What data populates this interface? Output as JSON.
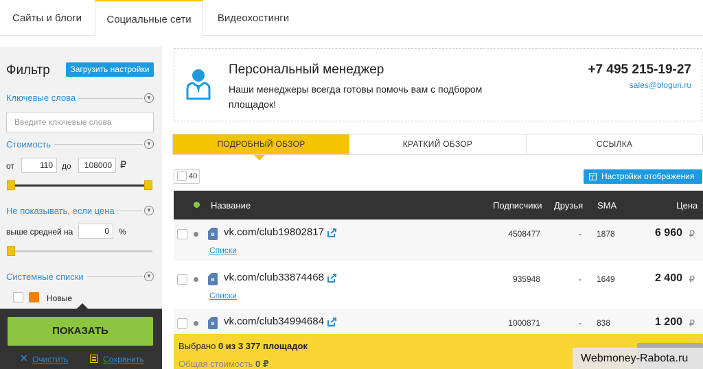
{
  "top_tabs": [
    {
      "label": "Сайты и блоги"
    },
    {
      "label": "Социальные сети"
    },
    {
      "label": "Видеохостинги"
    }
  ],
  "filter": {
    "title": "Фильтр",
    "load_settings": "Загрузить настройки",
    "keywords_label": "Ключевые слова",
    "keywords_placeholder": "Введите ключевые слова",
    "cost_label": "Стоимость",
    "from_label": "от",
    "from_value": "110",
    "to_label": "до",
    "to_value": "108000",
    "currency": "₽",
    "hide_label": "Не показывать, если цена",
    "above_label": "выше средней на",
    "above_value": "0",
    "percent": "%",
    "system_lists_label": "Системные списки",
    "new_label": "Новые",
    "show_button": "ПОКАЗАТЬ",
    "clear_link": "Очистить",
    "save_link": "Сохранить"
  },
  "manager": {
    "title": "Персональный менеджер",
    "text": "Наши менеджеры всегда готовы помочь вам с подбором площадок!",
    "phone": "+7 495 215-19-27",
    "email": "sales@blogun.ru"
  },
  "view_tabs": [
    {
      "label": "ПОДРОБНЫЙ ОБЗОР"
    },
    {
      "label": "КРАТКИЙ ОБЗОР"
    },
    {
      "label": "ССЫЛКА"
    }
  ],
  "per_page": "40",
  "display_settings": "Настройки отображения",
  "table": {
    "headers": {
      "name": "Название",
      "subscribers": "Подписчики",
      "friends": "Друзья",
      "sma": "SMA",
      "price": "Цена"
    },
    "rows": [
      {
        "name": "vk.com/club19802817",
        "lists": "Списки",
        "subscribers": "4508477",
        "friends": "-",
        "sma": "1878",
        "price": "6 960",
        "currency": "₽"
      },
      {
        "name": "vk.com/club33874468",
        "lists": "Списки",
        "subscribers": "935948",
        "friends": "-",
        "sma": "1649",
        "price": "2 400",
        "currency": "₽"
      },
      {
        "name": "vk.com/club34994684",
        "lists": "",
        "subscribers": "1000871",
        "friends": "-",
        "sma": "838",
        "price": "1 200",
        "currency": "₽"
      }
    ]
  },
  "footer": {
    "selected_prefix": "Выбрано ",
    "selected_count": "0 из 3 377 площадок",
    "total_prefix": "Общая стоимость ",
    "total_value": "0 ₽"
  },
  "watermark": "Webmoney-Rabota.ru",
  "colors": {
    "accent_yellow": "#f5c400",
    "link_blue": "#2c8ed6",
    "button_blue": "#1e9be0",
    "show_green": "#8cc63f",
    "dark": "#333333"
  }
}
